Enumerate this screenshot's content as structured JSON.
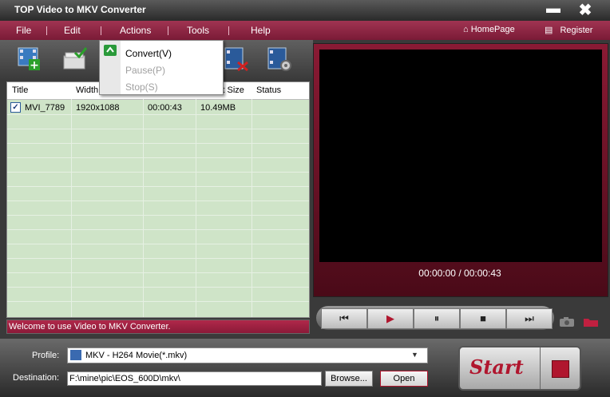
{
  "window": {
    "title": "TOP Video to MKV Converter",
    "minimize": "▬",
    "close": "✖"
  },
  "menu": {
    "items": [
      "File",
      "Edit",
      "Actions",
      "Tools",
      "Help"
    ],
    "homepage": "HomePage",
    "register": "Register"
  },
  "toolbar": {
    "icons": [
      "add-video-icon",
      "checkmark-icon",
      "trim-icon",
      "settings-icon"
    ]
  },
  "actions_menu": {
    "items": [
      {
        "label": "Convert(V)",
        "enabled": true
      },
      {
        "label": "Pause(P)",
        "enabled": false
      },
      {
        "label": "Stop(S)",
        "enabled": false
      }
    ]
  },
  "file_list": {
    "columns": [
      "Title",
      "Width...",
      "",
      "...put Size",
      "Status"
    ],
    "rows": [
      {
        "checked": true,
        "title": "MVI_7789",
        "resolution": "1920x1088",
        "duration": "00:00:43",
        "size": "10.49MB",
        "status": ""
      }
    ]
  },
  "status_message": "Welcome to use Video to MKV Converter.",
  "player": {
    "current_time": "00:00:00",
    "total_time": "00:00:43",
    "separator": "/",
    "controls": [
      "⏮",
      "▶",
      "⏸",
      "■",
      "⏭"
    ]
  },
  "profile": {
    "label": "Profile:",
    "value": "MKV - H264 Movie(*.mkv)"
  },
  "destination": {
    "label": "Destination:",
    "value": "F:\\mine\\pic\\EOS_600D\\mkv\\",
    "browse_label": "Browse...",
    "open_label": "Open"
  },
  "start": {
    "label": "Start"
  },
  "colors": {
    "accent": "#9a2444",
    "list_bg": "#cfe4c8",
    "start_text": "#b0162e"
  }
}
